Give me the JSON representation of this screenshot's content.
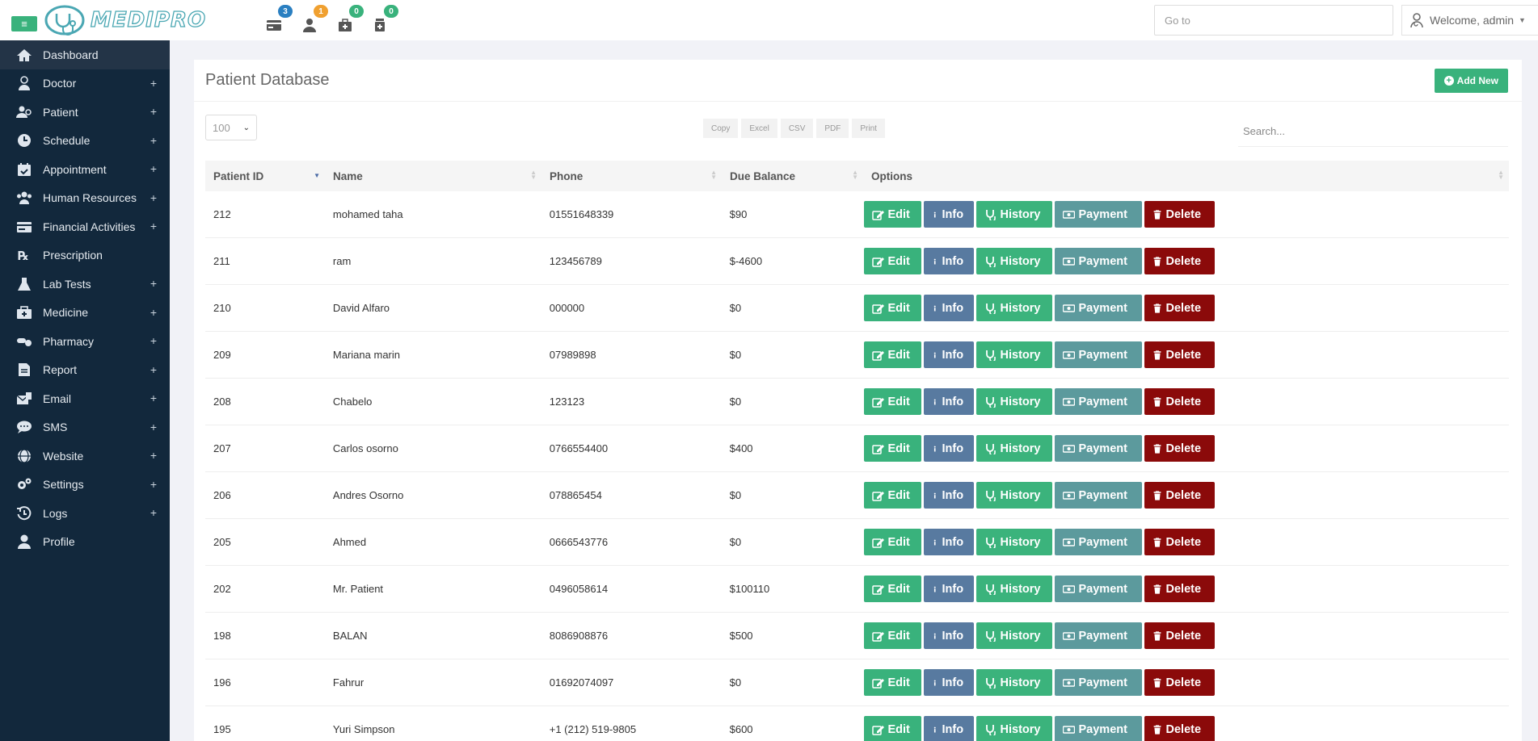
{
  "header": {
    "app_name": "MEDIPRO",
    "goto_placeholder": "Go to",
    "welcome": "Welcome, admin",
    "notifications": [
      {
        "icon": "payment-card-icon",
        "count": "3",
        "color": "#2a7fc1"
      },
      {
        "icon": "user-icon",
        "count": "1",
        "color": "#f0a030"
      },
      {
        "icon": "medical-kit-icon",
        "count": "0",
        "color": "#39b27c"
      },
      {
        "icon": "medicine-bottle-icon",
        "count": "0",
        "color": "#39b27c"
      }
    ]
  },
  "sidebar": {
    "items": [
      {
        "label": "Dashboard",
        "icon": "home-icon",
        "expand": ""
      },
      {
        "label": "Doctor",
        "icon": "doctor-icon",
        "expand": "+"
      },
      {
        "label": "Patient",
        "icon": "patients-icon",
        "expand": "+"
      },
      {
        "label": "Schedule",
        "icon": "clock-icon",
        "expand": "+"
      },
      {
        "label": "Appointment",
        "icon": "calendar-icon",
        "expand": "+"
      },
      {
        "label": "Human Resources",
        "icon": "users-icon",
        "expand": "+"
      },
      {
        "label": "Financial Activities",
        "icon": "money-card-icon",
        "expand": "+"
      },
      {
        "label": "Prescription",
        "icon": "prescription-icon",
        "expand": ""
      },
      {
        "label": "Lab Tests",
        "icon": "flask-icon",
        "expand": "+"
      },
      {
        "label": "Medicine",
        "icon": "medkit-icon",
        "expand": "+"
      },
      {
        "label": "Pharmacy",
        "icon": "pills-icon",
        "expand": "+"
      },
      {
        "label": "Report",
        "icon": "report-icon",
        "expand": "+"
      },
      {
        "label": "Email",
        "icon": "email-icon",
        "expand": "+"
      },
      {
        "label": "SMS",
        "icon": "sms-icon",
        "expand": "+"
      },
      {
        "label": "Website",
        "icon": "globe-icon",
        "expand": "+"
      },
      {
        "label": "Settings",
        "icon": "gears-icon",
        "expand": "+"
      },
      {
        "label": "Logs",
        "icon": "history-icon",
        "expand": "+"
      },
      {
        "label": "Profile",
        "icon": "profile-icon",
        "expand": ""
      }
    ]
  },
  "main": {
    "title": "Patient Database",
    "add_new_label": "Add New",
    "page_length": "100",
    "export_buttons": [
      "Copy",
      "Excel",
      "CSV",
      "PDF",
      "Print"
    ],
    "search_placeholder": "Search...",
    "columns": [
      "Patient ID",
      "Name",
      "Phone",
      "Due Balance",
      "Options"
    ],
    "actions": {
      "edit": "Edit",
      "info": "Info",
      "history": "History",
      "payment": "Payment",
      "delete": "Delete"
    },
    "rows": [
      {
        "id": "212",
        "name": "mohamed taha",
        "phone": "01551648339",
        "due": "$90"
      },
      {
        "id": "211",
        "name": "ram",
        "phone": "123456789",
        "due": "$-4600"
      },
      {
        "id": "210",
        "name": "David Alfaro",
        "phone": "000000",
        "due": "$0"
      },
      {
        "id": "209",
        "name": "Mariana marin",
        "phone": "07989898",
        "due": "$0"
      },
      {
        "id": "208",
        "name": "Chabelo",
        "phone": "123123",
        "due": "$0"
      },
      {
        "id": "207",
        "name": "Carlos osorno",
        "phone": "0766554400",
        "due": "$400"
      },
      {
        "id": "206",
        "name": "Andres Osorno",
        "phone": "078865454",
        "due": "$0"
      },
      {
        "id": "205",
        "name": "Ahmed",
        "phone": "0666543776",
        "due": "$0"
      },
      {
        "id": "202",
        "name": "Mr. Patient",
        "phone": "0496058614",
        "due": "$100110"
      },
      {
        "id": "198",
        "name": "BALAN",
        "phone": "8086908876",
        "due": "$500"
      },
      {
        "id": "196",
        "name": "Fahrur",
        "phone": "01692074097",
        "due": "$0"
      },
      {
        "id": "195",
        "name": "Yuri Simpson",
        "phone": "+1 (212) 519-9805",
        "due": "$600"
      }
    ]
  }
}
